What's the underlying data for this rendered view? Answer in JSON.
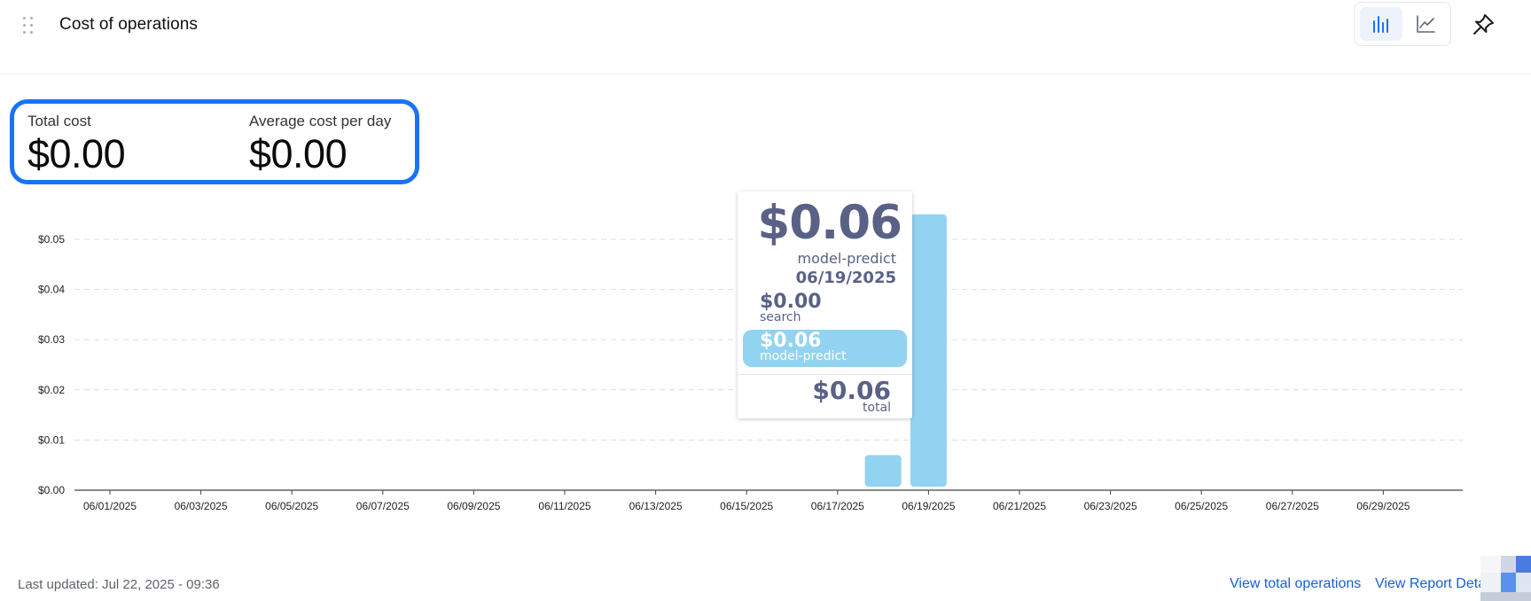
{
  "header": {
    "title": "Cost of operations",
    "view_modes": [
      "bar-chart-icon",
      "line-chart-icon"
    ],
    "active_view": "bar"
  },
  "kpis": [
    {
      "label": "Total cost",
      "value": "$0.00"
    },
    {
      "label": "Average cost per day",
      "value": "$0.00"
    }
  ],
  "tooltip": {
    "value": "$0.06",
    "series": "model-predict",
    "date": "06/19/2025",
    "rows": [
      {
        "value": "$0.00",
        "name": "search",
        "highlighted": false
      },
      {
        "value": "$0.06",
        "name": "model-predict",
        "highlighted": true
      }
    ],
    "total_value": "$0.06",
    "total_label": "total"
  },
  "chart_data": {
    "type": "bar",
    "stacked": true,
    "x_tick_labels": [
      "06/01/2025",
      "06/03/2025",
      "06/05/2025",
      "06/07/2025",
      "06/09/2025",
      "06/11/2025",
      "06/13/2025",
      "06/15/2025",
      "06/17/2025",
      "06/19/2025",
      "06/21/2025",
      "06/23/2025",
      "06/25/2025",
      "06/27/2025",
      "06/29/2025"
    ],
    "x": [
      "06/18/2025",
      "06/19/2025"
    ],
    "series": [
      {
        "name": "search",
        "values": [
          0.0,
          0.0
        ]
      },
      {
        "name": "model-predict",
        "values": [
          0.007,
          0.055
        ]
      }
    ],
    "y_ticks": [
      "$0.05",
      "$0.04",
      "$0.03",
      "$0.02",
      "$0.01",
      "$0.00"
    ],
    "ylim": [
      0,
      0.05
    ],
    "grid": true,
    "bar_color": "#92d3f1"
  },
  "footer": {
    "last_updated": "Last updated: Jul 22, 2025 - 09:36",
    "links": [
      "View total operations",
      "View Report Details"
    ]
  },
  "colors": {
    "accent": "#1a73f5",
    "link": "#1a5fd0",
    "tooltip_text": "#5a6187",
    "bar": "#92d3f1"
  }
}
